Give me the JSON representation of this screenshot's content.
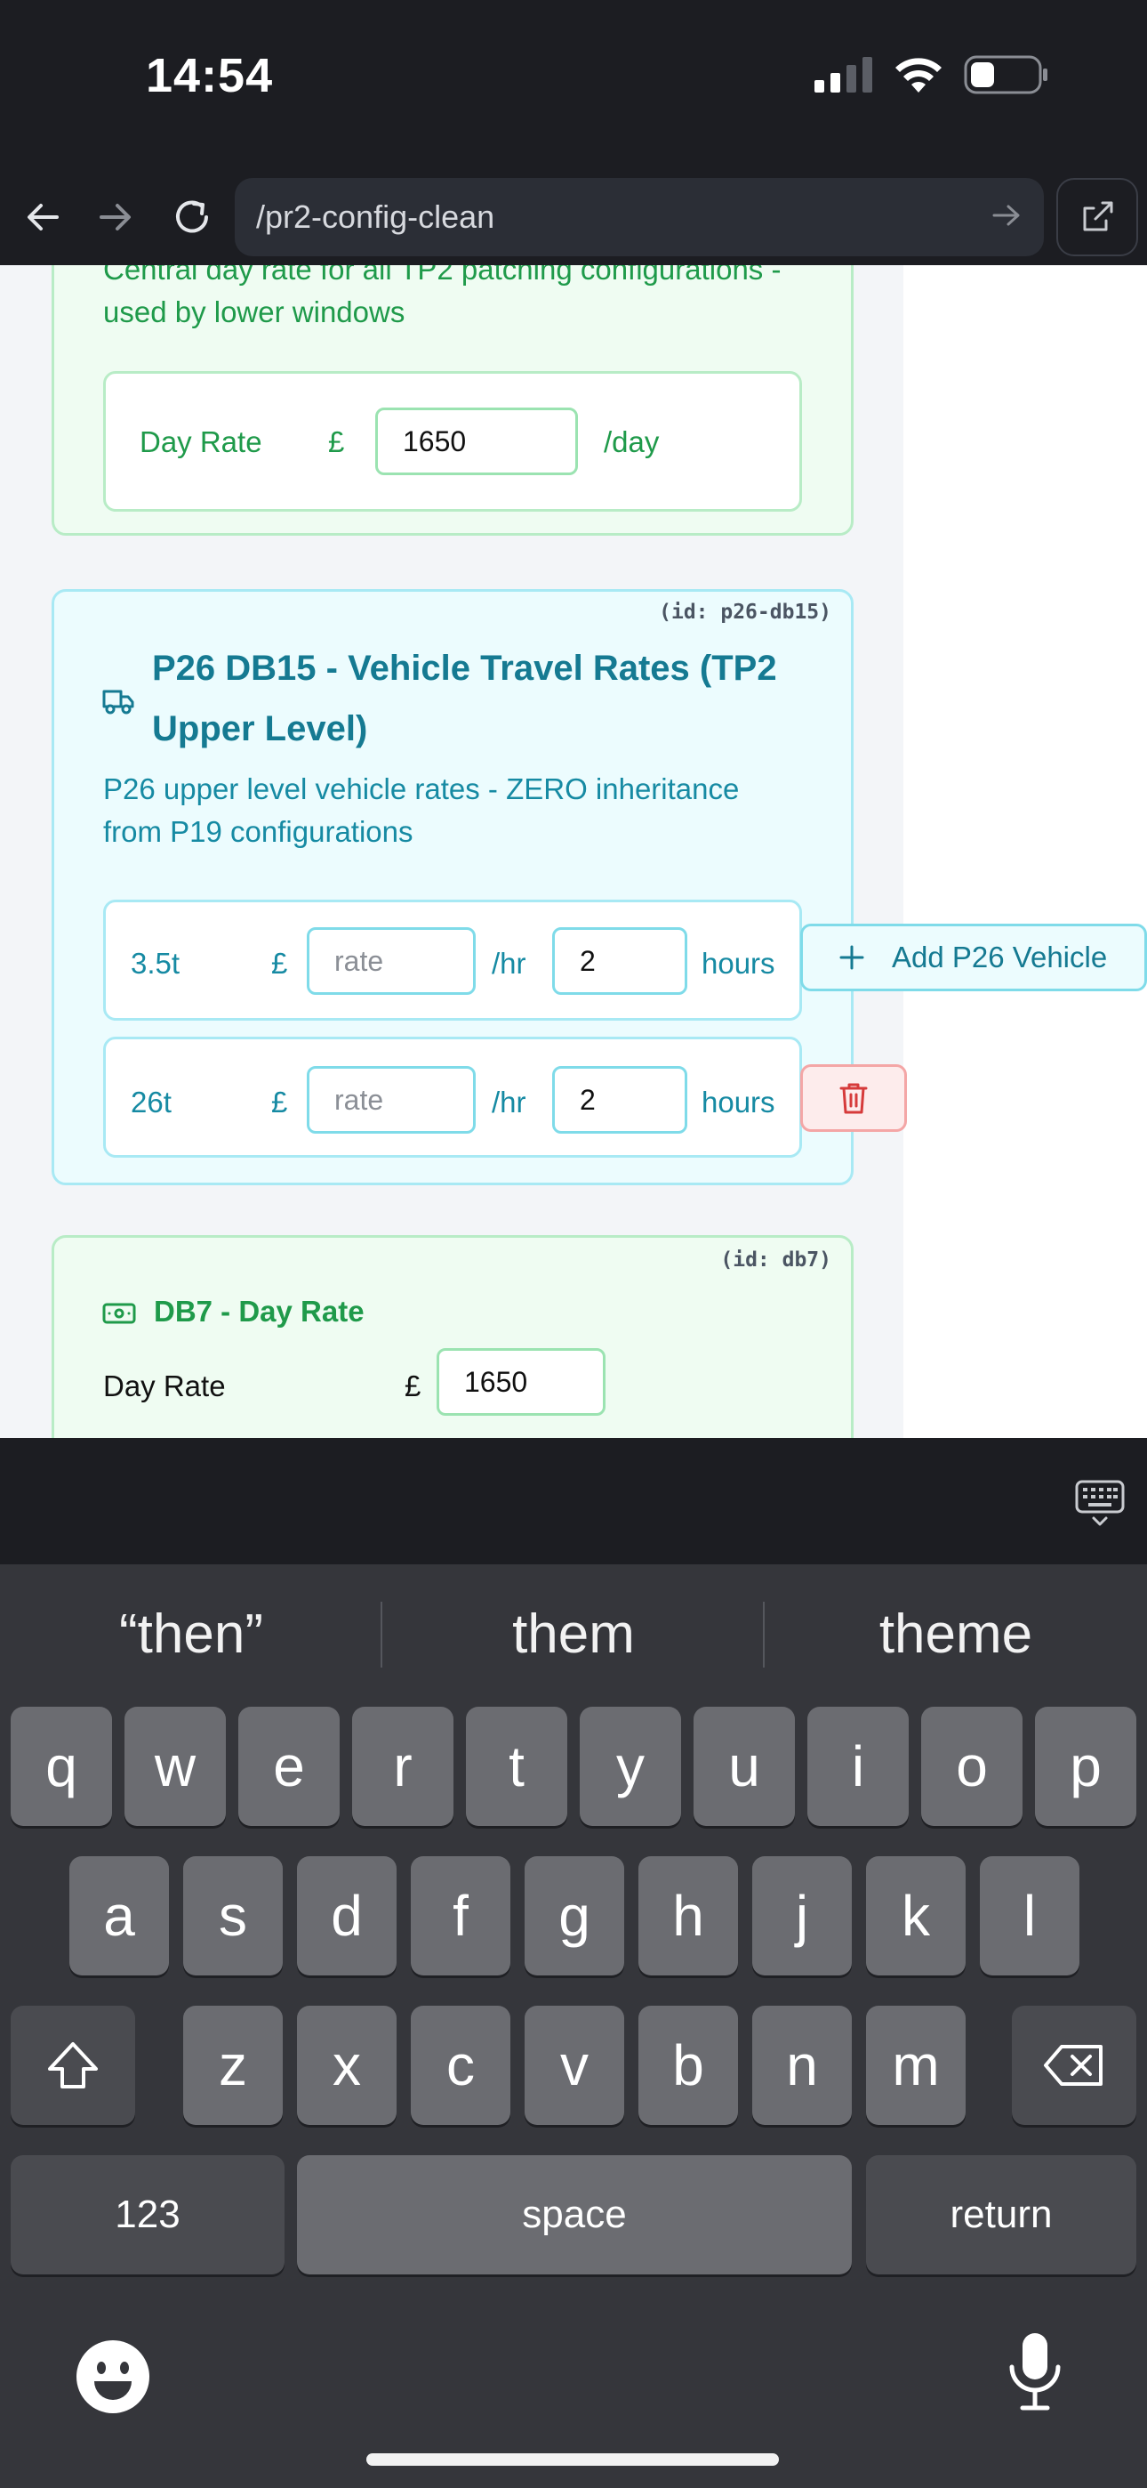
{
  "status_bar": {
    "time": "14:54"
  },
  "browser": {
    "url": "/pr2-config-clean"
  },
  "cards": {
    "top": {
      "desc_line1": "Central day rate for all TP2 patching configurations -",
      "desc_line2": "used by lower windows",
      "day_rate_label": "Day Rate",
      "currency": "£",
      "day_rate_value": "1650",
      "unit": "/day"
    },
    "p26": {
      "id_tag": "(id: p26-db15)",
      "title_line1": "P26 DB15 - Vehicle Travel Rates (TP2",
      "title_line2": "Upper Level)",
      "desc_line1": "P26 upper level vehicle rates - ZERO inheritance",
      "desc_line2": "from P19 configurations",
      "rows": [
        {
          "vehicle": "3.5t",
          "currency": "£",
          "rate_placeholder": "rate",
          "rate_unit": "/hr",
          "hours": "2",
          "hours_unit": "hours"
        },
        {
          "vehicle": "26t",
          "currency": "£",
          "rate_placeholder": "rate",
          "rate_unit": "/hr",
          "hours": "2",
          "hours_unit": "hours"
        }
      ],
      "add_button": "Add P26 Vehicle"
    },
    "db7": {
      "id_tag": "(id: db7)",
      "title": "DB7 - Day Rate",
      "day_rate_label": "Day Rate",
      "currency": "£",
      "day_rate_value": "1650"
    }
  },
  "keyboard": {
    "suggestions": [
      "“then”",
      "them",
      "theme"
    ],
    "row1": [
      "q",
      "w",
      "e",
      "r",
      "t",
      "y",
      "u",
      "i",
      "o",
      "p"
    ],
    "row2": [
      "a",
      "s",
      "d",
      "f",
      "g",
      "h",
      "j",
      "k",
      "l"
    ],
    "row3": [
      "z",
      "x",
      "c",
      "v",
      "b",
      "n",
      "m"
    ],
    "numbers_key": "123",
    "space_key": "space",
    "return_key": "return"
  }
}
